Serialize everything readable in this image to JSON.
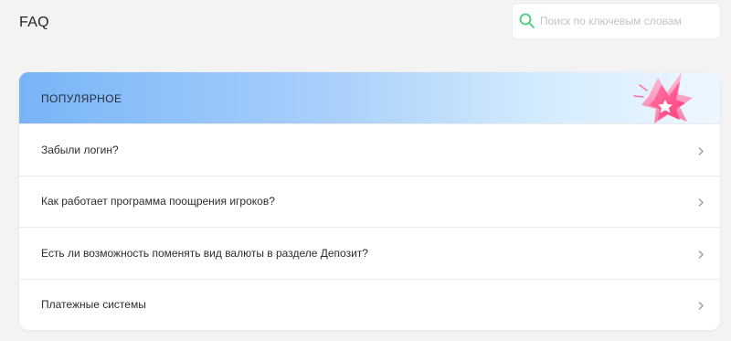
{
  "page": {
    "title": "FAQ"
  },
  "search": {
    "placeholder": "Поиск по ключевым словам",
    "icon": "search-icon",
    "icon_color": "#3fcf79"
  },
  "section": {
    "title": "ПОПУЛЯРНОЕ",
    "items": [
      {
        "question": "Забыли логин?"
      },
      {
        "question": "Как работает программа поощрения игроков?"
      },
      {
        "question": "Есть ли возможность поменять вид валюты в разделе Депозит?"
      },
      {
        "question": "Платежные системы"
      }
    ]
  },
  "colors": {
    "header_gradient_start": "#79b4f8",
    "header_gradient_end": "#eef7ff",
    "background": "#f3f3f3"
  }
}
